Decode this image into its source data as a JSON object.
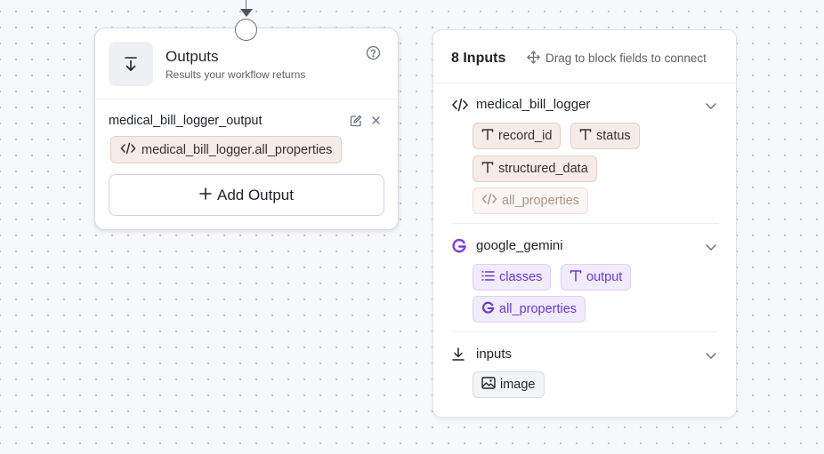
{
  "outputs_card": {
    "title": "Outputs",
    "subtitle": "Results your workflow returns",
    "field_label": "medical_bill_logger_output",
    "field_value": "medical_bill_logger.all_properties",
    "add_button": "Add Output",
    "icons": {
      "header": "arrow-down-icon",
      "help": "help-icon",
      "edit": "edit-icon",
      "close": "close-icon",
      "add": "plus-icon",
      "code": "code-icon"
    }
  },
  "inputs_panel": {
    "title": "8 Inputs",
    "drag_hint": "Drag to block fields to connect",
    "groups": [
      {
        "name": "medical_bill_logger",
        "icon": "code-icon",
        "fields": [
          {
            "label": "record_id",
            "icon": "text-type-icon"
          },
          {
            "label": "status",
            "icon": "text-type-icon"
          },
          {
            "label": "structured_data",
            "icon": "text-type-icon"
          },
          {
            "label": "all_properties",
            "icon": "code-icon",
            "faded": true
          }
        ]
      },
      {
        "name": "google_gemini",
        "icon": "google-icon",
        "fields": [
          {
            "label": "classes",
            "icon": "list-icon"
          },
          {
            "label": "output",
            "icon": "text-type-icon"
          },
          {
            "label": "all_properties",
            "icon": "google-icon"
          }
        ]
      },
      {
        "name": "inputs",
        "icon": "download-icon",
        "fields": [
          {
            "label": "image",
            "icon": "image-icon"
          }
        ]
      }
    ]
  },
  "colors": {
    "tan_chip_bg": "#f6ece7",
    "purple_chip_bg": "#f1ecfd",
    "purple_text": "#6d35d1",
    "google_purple": "#7c3aed"
  }
}
